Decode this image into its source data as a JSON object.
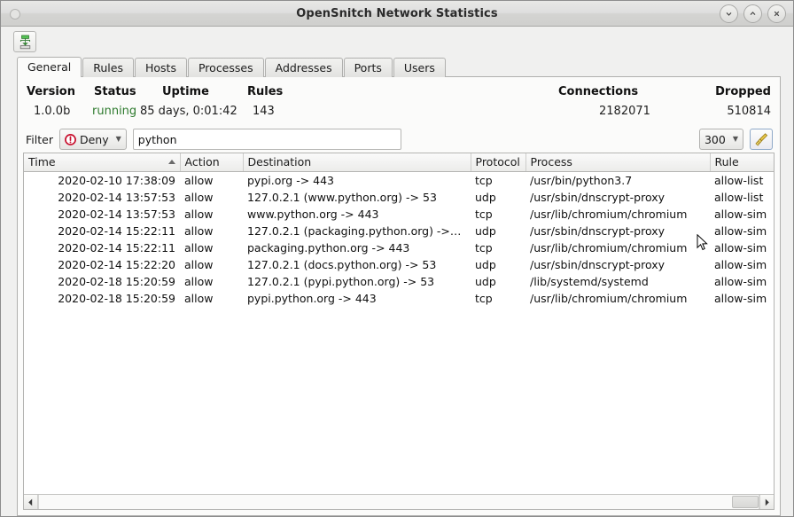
{
  "window": {
    "title": "OpenSnitch Network Statistics",
    "minimize_label": "⌄",
    "maximize_label": "⌃",
    "close_label": "✕"
  },
  "toolbar": {
    "export_icon": "network-download-icon"
  },
  "tabs": [
    {
      "label": "General",
      "active": true
    },
    {
      "label": "Rules",
      "active": false
    },
    {
      "label": "Hosts",
      "active": false
    },
    {
      "label": "Processes",
      "active": false
    },
    {
      "label": "Addresses",
      "active": false
    },
    {
      "label": "Ports",
      "active": false
    },
    {
      "label": "Users",
      "active": false
    }
  ],
  "stats": {
    "version_label": "Version",
    "version_value": "1.0.0b",
    "status_label": "Status",
    "status_value": "running",
    "status_color": "#2d7a2d",
    "uptime_label": "Uptime",
    "uptime_value": "85 days, 0:01:42",
    "rules_label": "Rules",
    "rules_value": "143",
    "connections_label": "Connections",
    "connections_value": "2182071",
    "dropped_label": "Dropped",
    "dropped_value": "510814"
  },
  "filter": {
    "label": "Filter",
    "action_selected": "Deny",
    "action_icon": "deny-icon",
    "action_icon_color": "#c8102e",
    "query_value": "python",
    "query_placeholder": "",
    "limit_selected": "300",
    "clear_icon": "broom-icon"
  },
  "table": {
    "columns": [
      {
        "key": "time",
        "label": "Time",
        "sorted": "asc"
      },
      {
        "key": "action",
        "label": "Action",
        "sorted": ""
      },
      {
        "key": "dest",
        "label": "Destination",
        "sorted": ""
      },
      {
        "key": "protocol",
        "label": "Protocol",
        "sorted": ""
      },
      {
        "key": "process",
        "label": "Process",
        "sorted": ""
      },
      {
        "key": "rule",
        "label": "Rule",
        "sorted": ""
      }
    ],
    "rows": [
      {
        "time": "2020-02-10 17:38:09",
        "action": "allow",
        "dest": "pypi.org  ->  443",
        "protocol": "tcp",
        "process": "/usr/bin/python3.7",
        "rule": "allow-list"
      },
      {
        "time": "2020-02-14 13:57:53",
        "action": "allow",
        "dest": "127.0.2.1 (www.python.org)  ->  53",
        "protocol": "udp",
        "process": "/usr/sbin/dnscrypt-proxy",
        "rule": "allow-list"
      },
      {
        "time": "2020-02-14 13:57:53",
        "action": "allow",
        "dest": "www.python.org  ->  443",
        "protocol": "tcp",
        "process": "/usr/lib/chromium/chromium",
        "rule": "allow-sim"
      },
      {
        "time": "2020-02-14 15:22:11",
        "action": "allow",
        "dest": "127.0.2.1 (packaging.python.org)  ->…",
        "protocol": "udp",
        "process": "/usr/sbin/dnscrypt-proxy",
        "rule": "allow-sim"
      },
      {
        "time": "2020-02-14 15:22:11",
        "action": "allow",
        "dest": "packaging.python.org  ->  443",
        "protocol": "tcp",
        "process": "/usr/lib/chromium/chromium",
        "rule": "allow-sim"
      },
      {
        "time": "2020-02-14 15:22:20",
        "action": "allow",
        "dest": "127.0.2.1 (docs.python.org)  ->  53",
        "protocol": "udp",
        "process": "/usr/sbin/dnscrypt-proxy",
        "rule": "allow-sim"
      },
      {
        "time": "2020-02-18 15:20:59",
        "action": "allow",
        "dest": "127.0.2.1 (pypi.python.org)  ->  53",
        "protocol": "udp",
        "process": "/lib/systemd/systemd",
        "rule": "allow-sim"
      },
      {
        "time": "2020-02-18 15:20:59",
        "action": "allow",
        "dest": "pypi.python.org  ->  443",
        "protocol": "tcp",
        "process": "/usr/lib/chromium/chromium",
        "rule": "allow-sim"
      }
    ]
  },
  "scrollbar": {
    "left_arrow": "◀",
    "right_arrow": "▶"
  }
}
